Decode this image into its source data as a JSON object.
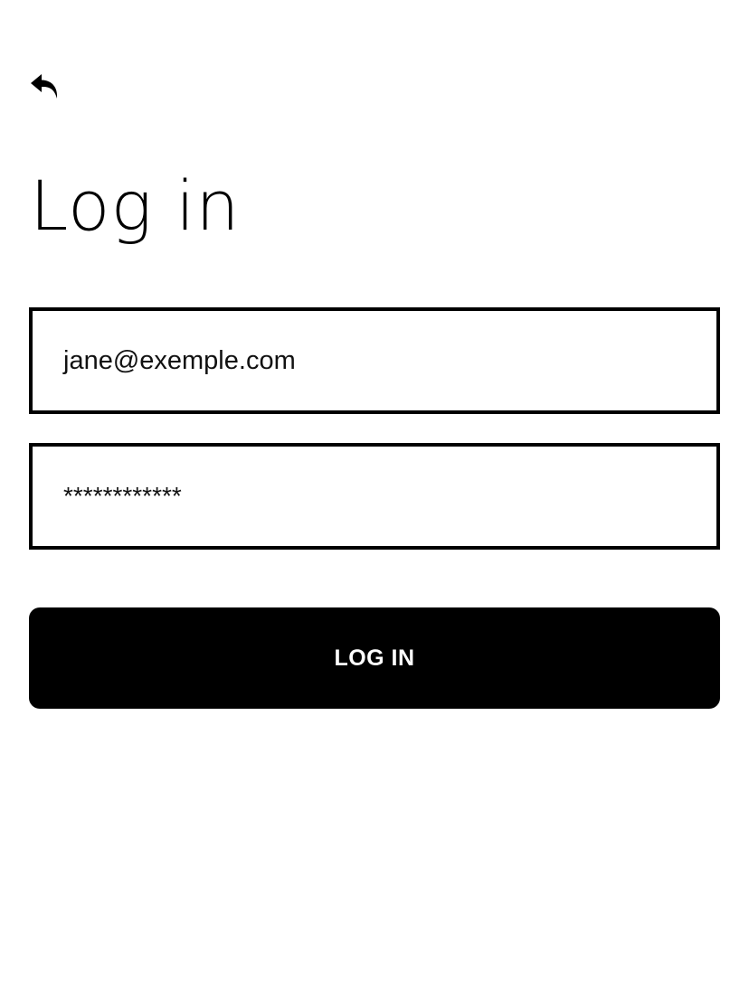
{
  "icons": {
    "back": "back-arrow-icon"
  },
  "header": {
    "title": "Log in"
  },
  "form": {
    "email_value": "jane@exemple.com",
    "password_value": "************",
    "submit_label": "LOG IN"
  },
  "colors": {
    "primary": "#000000",
    "background": "#ffffff",
    "button_text": "#ffffff"
  }
}
